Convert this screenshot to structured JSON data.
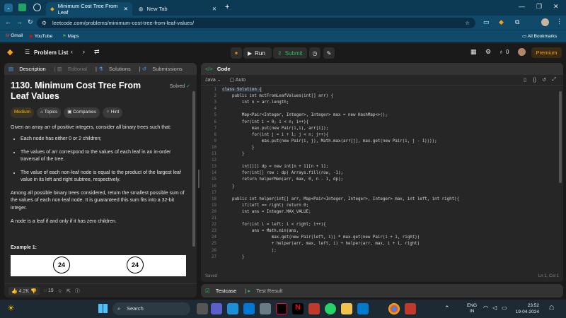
{
  "tabs": [
    {
      "label": "Minimum Cost Tree From Leaf"
    },
    {
      "label": "New Tab"
    }
  ],
  "url": "leetcode.com/problems/minimum-cost-tree-from-leaf-values/",
  "bookmarks": {
    "gmail": "Gmail",
    "youtube": "YouTube",
    "maps": "Maps",
    "all": "All Bookmarks"
  },
  "lc": {
    "problem_list": "Problem List",
    "run": "Run",
    "submit": "Submit",
    "streak": "0",
    "premium": "Premium"
  },
  "left_tabs": {
    "description": "Description",
    "editorial": "Editorial",
    "solutions": "Solutions",
    "submissions": "Submissions"
  },
  "problem": {
    "title": "1130. Minimum Cost Tree From Leaf Values",
    "solved": "Solved",
    "difficulty": "Medium",
    "topics": "Topics",
    "companies": "Companies",
    "hint": "Hint",
    "p1": "Given an array arr of positive integers, consider all binary trees such that:",
    "b1": "Each node has either 0 or 2 children;",
    "b2": "The values of arr correspond to the values of each leaf in an in-order traversal of the tree.",
    "b3": "The value of each non-leaf node is equal to the product of the largest leaf value in its left and right subtree, respectively.",
    "p2": "Among all possible binary trees considered, return the smallest possible sum of the values of each non-leaf node. It is guaranteed this sum fits into a 32-bit integer.",
    "p3": "A node is a leaf if and only if it has zero children.",
    "example": "Example 1:",
    "node_a": "24",
    "node_b": "24"
  },
  "footer": {
    "likes": "4.2K",
    "comments": "19"
  },
  "code_panel": {
    "title": "Code",
    "lang": "Java",
    "mode": "Auto",
    "saved": "Saved",
    "pos": "Ln 1, Col 1"
  },
  "code_lines": [
    "class Solution {",
    "    public int mctFromLeafValues(int[] arr) {",
    "        int n = arr.length;",
    "",
    "        Map<Pair<Integer, Integer>, Integer> max = new HashMap<>();",
    "        for(int i = 0; i < n; i++){",
    "            max.put(new Pair(i,i), arr[i]);",
    "            for(int j = i + 1; j < n; j++){",
    "                max.put(new Pair(i, j), Math.max(arr[j], max.get(new Pair(i, j - 1))));",
    "            }",
    "        }",
    "",
    "        int[][] dp = new int[n + 1][n + 1];",
    "        for(int[] row : dp) Arrays.fill(row, -1);",
    "        return helperMem(arr, max, 0, n - 1, dp);",
    "    }",
    "",
    "    public int helper(int[] arr, Map<Pair<Integer, Integer>, Integer> max, int left, int right){",
    "        if(left == right) return 0;",
    "        int ans = Integer.MAX_VALUE;",
    "",
    "        for(int i = left; i < right; i++){",
    "            ans = Math.min(ans,",
    "                    max.get(new Pair(left, i)) * max.get(new Pair(i + 1, right))",
    "                    + helper(arr, max, left, i) + helper(arr, max, i + 1, right)",
    "                    );",
    "        }"
  ],
  "bottom": {
    "testcase": "Testcase",
    "result": "Test Result"
  },
  "taskbar": {
    "search": "Search",
    "lang1": "ENG",
    "lang2": "IN",
    "time": "23:52",
    "date": "19-04-2024"
  }
}
